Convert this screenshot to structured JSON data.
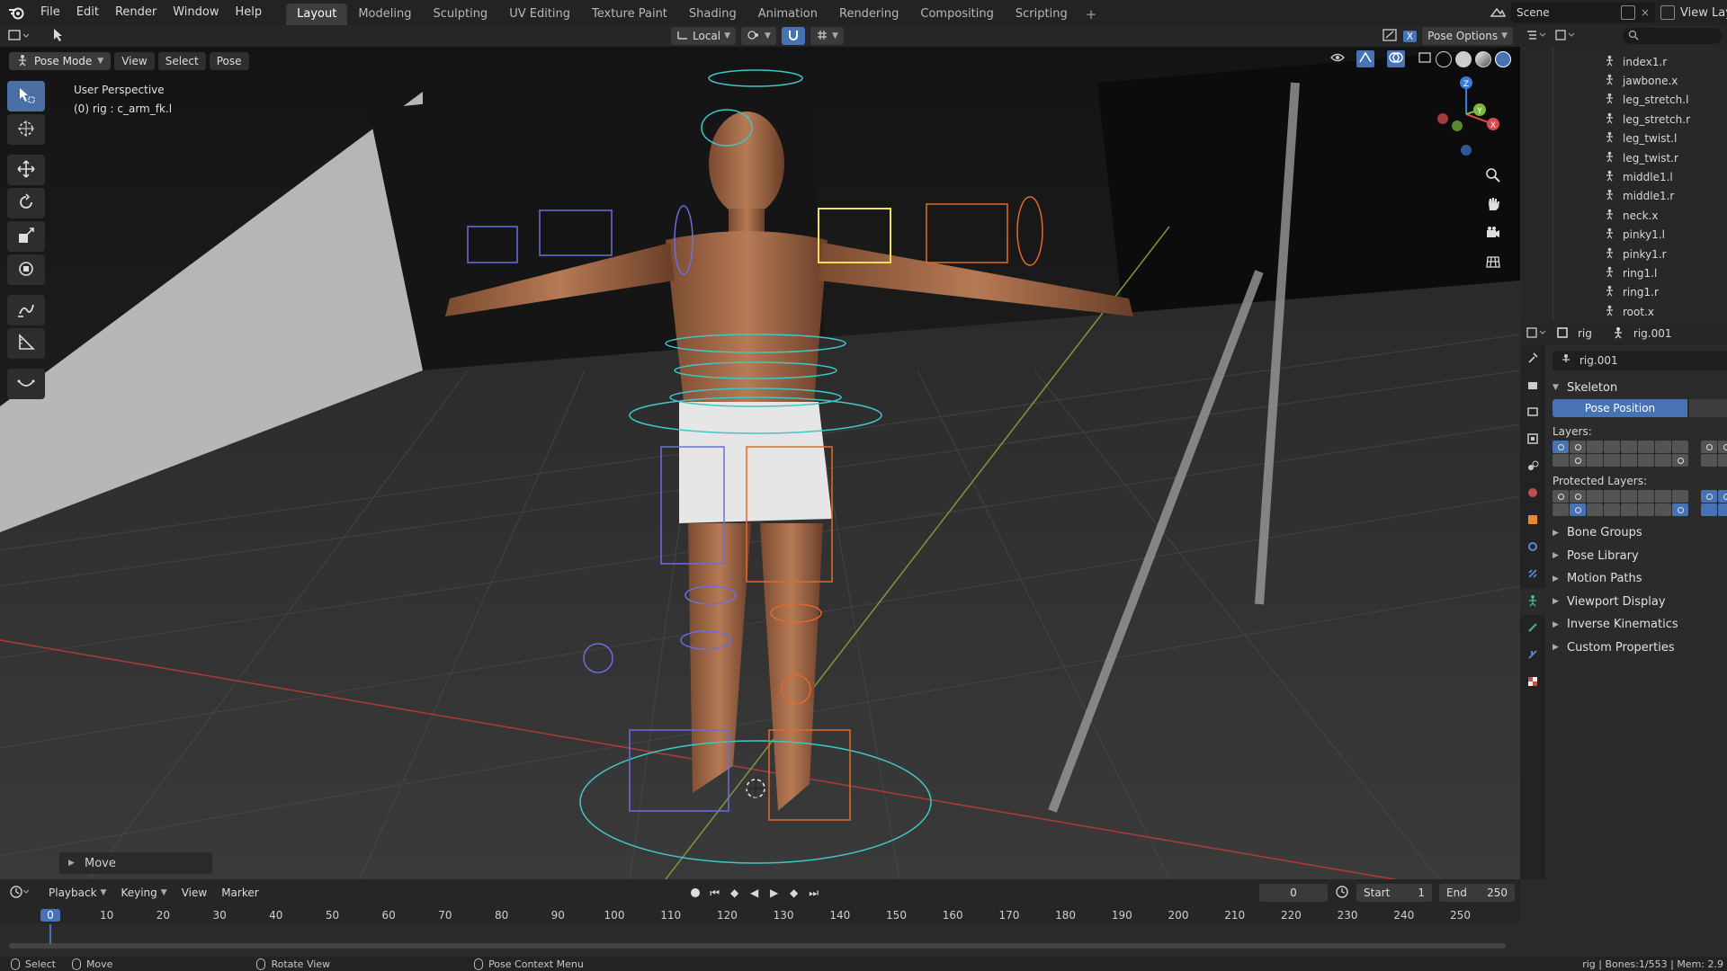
{
  "topbar": {
    "menus": [
      "File",
      "Edit",
      "Render",
      "Window",
      "Help"
    ],
    "workspaces": [
      "Layout",
      "Modeling",
      "Sculpting",
      "UV Editing",
      "Texture Paint",
      "Shading",
      "Animation",
      "Rendering",
      "Compositing",
      "Scripting"
    ],
    "active_workspace": "Layout",
    "scene_name": "Scene",
    "view_layer": "View Lay"
  },
  "viewport_header": {
    "transform_orientation": "Local",
    "pose_options": "Pose Options"
  },
  "viewport": {
    "mode": "Pose Mode",
    "menus": [
      "View",
      "Select",
      "Pose"
    ],
    "perspective_label": "User Perspective",
    "active_object_label": "(0) rig : c_arm_fk.l",
    "last_operator": "Move",
    "gizmo_axes": [
      "X",
      "Y",
      "Z"
    ]
  },
  "outliner": {
    "items": [
      "index1.r",
      "jawbone.x",
      "leg_stretch.l",
      "leg_stretch.r",
      "leg_twist.l",
      "leg_twist.r",
      "middle1.l",
      "middle1.r",
      "neck.x",
      "pinky1.l",
      "pinky1.r",
      "ring1.l",
      "ring1.r",
      "root.x"
    ]
  },
  "properties": {
    "breadcrumb_object": "rig",
    "breadcrumb_data": "rig.001",
    "data_name": "rig.001",
    "panel_skeleton": "Skeleton",
    "pose_position_label": "Pose Position",
    "layers_label": "Layers:",
    "protected_layers_label": "Protected Layers:",
    "collapsed_panels": [
      "Bone Groups",
      "Pose Library",
      "Motion Paths",
      "Viewport Display",
      "Inverse Kinematics",
      "Custom Properties"
    ]
  },
  "timeline": {
    "menus": [
      "Playback",
      "Keying",
      "View",
      "Marker"
    ],
    "current_frame": "0",
    "start_label": "Start",
    "start_value": "1",
    "end_label": "End",
    "end_value": "250",
    "ruler_ticks": [
      "0",
      "10",
      "20",
      "30",
      "40",
      "50",
      "60",
      "70",
      "80",
      "90",
      "100",
      "110",
      "120",
      "130",
      "140",
      "150",
      "160",
      "170",
      "180",
      "190",
      "200",
      "210",
      "220",
      "230",
      "240",
      "250"
    ]
  },
  "statusbar": {
    "select": "Select",
    "move": "Move",
    "rotate_view": "Rotate View",
    "context_menu": "Pose Context Menu",
    "stats": "rig | Bones:1/553 | Mem: 2.9"
  },
  "colors": {
    "accent": "#4772b3",
    "bone_teal": "#3fc7c7",
    "bone_orange": "#e06a2a",
    "bone_blue": "#6a6ee0",
    "bone_selected": "#f2e05a"
  }
}
